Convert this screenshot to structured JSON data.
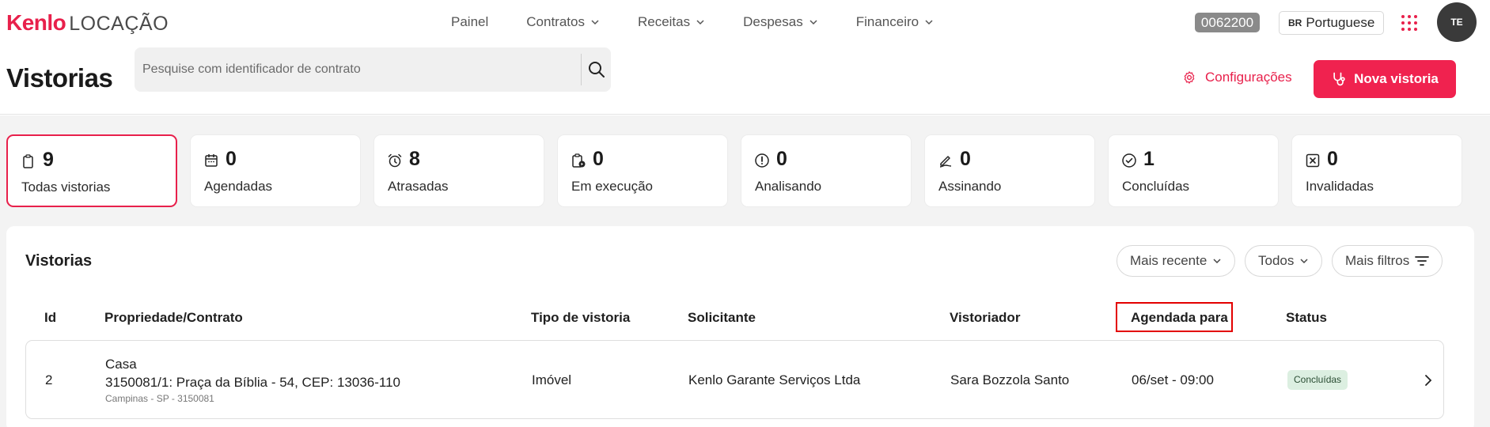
{
  "logo": {
    "brand": "Kenlo",
    "product": "LOCAÇÃO"
  },
  "nav": [
    {
      "label": "Painel",
      "has_dropdown": false
    },
    {
      "label": "Contratos",
      "has_dropdown": true
    },
    {
      "label": "Receitas",
      "has_dropdown": true
    },
    {
      "label": "Despesas",
      "has_dropdown": true
    },
    {
      "label": "Financeiro",
      "has_dropdown": true
    }
  ],
  "header": {
    "account_id": "0062200",
    "language": {
      "flag": "BR",
      "label": "Portuguese"
    },
    "avatar_initials": "TE",
    "page_title": "Vistorias",
    "search_placeholder": "Pesquise com identificador de contrato",
    "settings_label": "Configurações",
    "new_button_label": "Nova vistoria"
  },
  "stats": [
    {
      "count": "9",
      "label": "Todas vistorias",
      "icon": "clipboard-icon",
      "active": true
    },
    {
      "count": "0",
      "label": "Agendadas",
      "icon": "calendar-icon",
      "active": false
    },
    {
      "count": "8",
      "label": "Atrasadas",
      "icon": "alarm-clock-icon",
      "active": false
    },
    {
      "count": "0",
      "label": "Em execução",
      "icon": "clipboard-play-icon",
      "active": false
    },
    {
      "count": "0",
      "label": "Analisando",
      "icon": "alert-circle-icon",
      "active": false
    },
    {
      "count": "0",
      "label": "Assinando",
      "icon": "signature-pen-icon",
      "active": false
    },
    {
      "count": "1",
      "label": "Concluídas",
      "icon": "check-circle-icon",
      "active": false
    },
    {
      "count": "0",
      "label": "Invalidadas",
      "icon": "x-square-icon",
      "active": false
    }
  ],
  "panel": {
    "title": "Vistorias",
    "sort_label": "Mais recente",
    "scope_label": "Todos",
    "more_filters_label": "Mais filtros"
  },
  "table": {
    "columns": [
      "Id",
      "Propriedade/Contrato",
      "Tipo de vistoria",
      "Solicitante",
      "Vistoriador",
      "Agendada para",
      "Status"
    ],
    "rows": [
      {
        "id": "2",
        "property_type": "Casa",
        "contract": "3150081/1: Praça da Bíblia - 54, CEP: 13036-110",
        "location": "Campinas - SP - 3150081",
        "inspection_type": "Imóvel",
        "requester": "Kenlo Garante Serviços Ltda",
        "inspector": "Sara Bozzola Santo",
        "scheduled_for": "06/set - 09:00",
        "status": "Concluídas"
      }
    ]
  },
  "colors": {
    "accent": "#e8204b",
    "status_done_bg": "#dcefe1",
    "highlight_box": "#e30000"
  }
}
